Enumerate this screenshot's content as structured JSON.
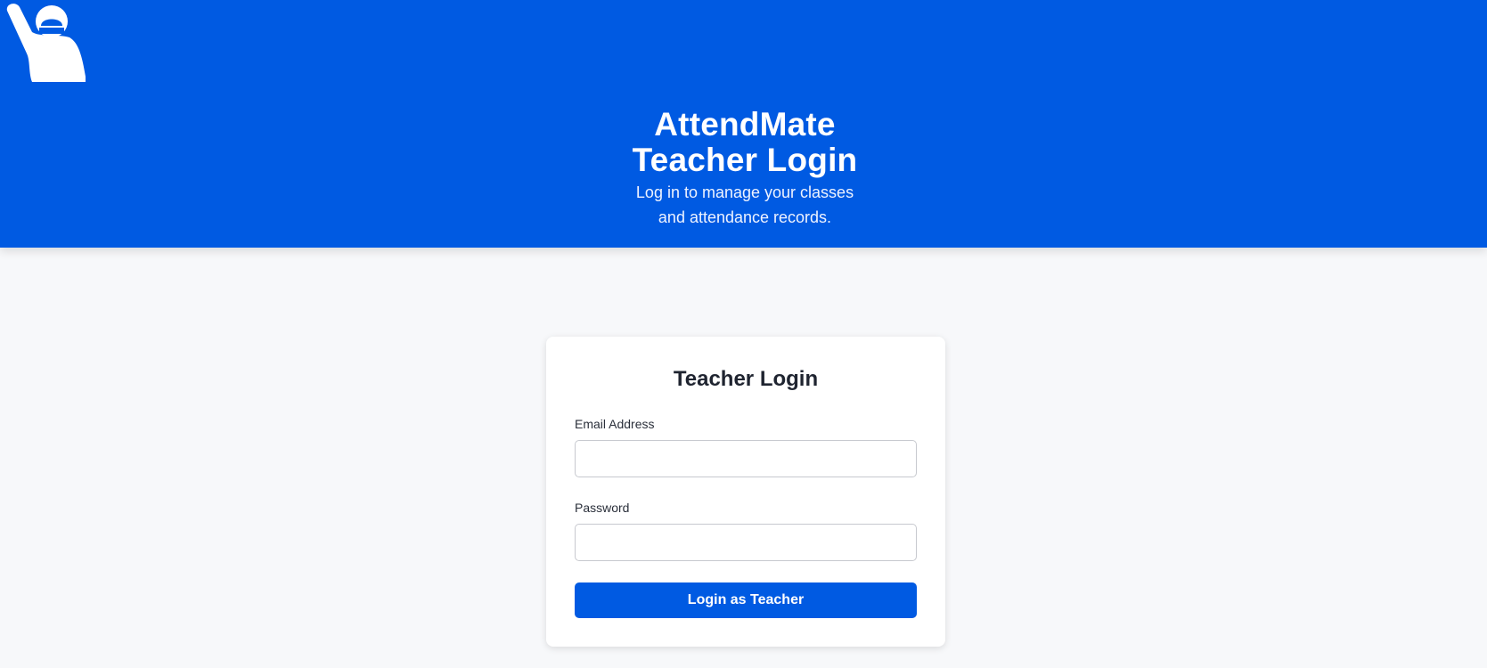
{
  "header": {
    "logo_icon": "raised-hand-logo-icon",
    "title_line1": "AttendMate",
    "title_line2": "Teacher Login",
    "subtitle_line1": "Log in to manage your classes",
    "subtitle_line2": "and attendance records."
  },
  "login_card": {
    "title": "Teacher Login",
    "email_label": "Email Address",
    "email_value": "",
    "password_label": "Password",
    "password_value": "",
    "submit_label": "Login as Teacher"
  },
  "colors": {
    "brand_blue": "#005ae2",
    "page_background": "#f7f8fa",
    "card_background": "#ffffff",
    "heading_text": "#1f2430"
  }
}
